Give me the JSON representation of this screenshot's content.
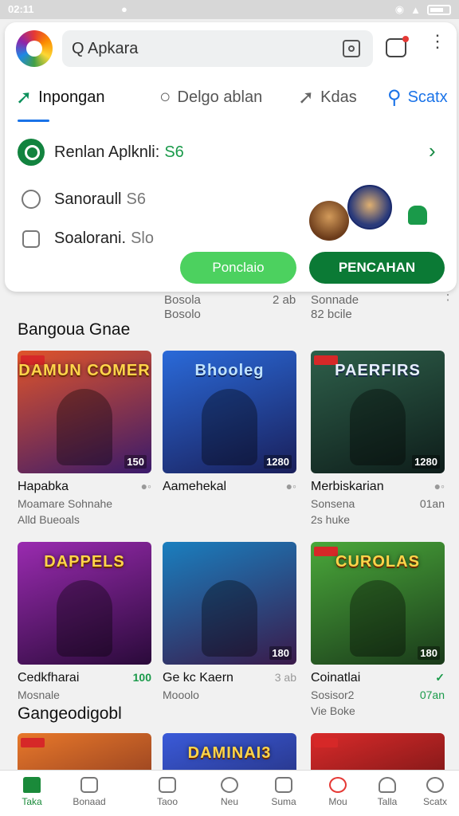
{
  "status": {
    "time": "02:11",
    "notif_icon": "bell-icon"
  },
  "header": {
    "search_value": "Q Apkara"
  },
  "tabs": [
    {
      "label": "Inpongan",
      "icon": "share-arrow-icon",
      "active": true
    },
    {
      "label": "Delgo ablan",
      "icon": "chat-bubble-icon"
    },
    {
      "label": "Kdas",
      "icon": "forward-arrow-icon"
    },
    {
      "label": "Scatx",
      "icon": "search-icon"
    }
  ],
  "options": [
    {
      "label": "Renlan Aplknli:",
      "badge": "S6"
    },
    {
      "label": "Sanoraull",
      "badge": "S6"
    },
    {
      "label": "Soalorani.",
      "badge": "Slo"
    }
  ],
  "buttons": {
    "light": "Ponclaio",
    "dark": "PENCAHAN"
  },
  "peek": {
    "col2": [
      "Bosola",
      "Bosolo"
    ],
    "col2_num": "2 ab",
    "col3": [
      "Sonnade",
      "82 bcile"
    ]
  },
  "sections": [
    "Bangoua Gnae",
    "Gangeodigobl"
  ],
  "games": [
    {
      "title": "DAMUN COMER",
      "name": "Hapabka",
      "sub1": "Moamare Sohnahe",
      "sub2": "Alld Bueoals",
      "num": "150",
      "colors": [
        "#e0542a",
        "#3a1a6b"
      ]
    },
    {
      "title": "Bhooleg",
      "name": "Aamehekal",
      "sub1": "",
      "sub2": "",
      "num": "1280",
      "colors": [
        "#2a6ad9",
        "#1a1f5a"
      ]
    },
    {
      "title": "PAERFIRS",
      "name": "Merbiskarian",
      "sub1": "Sonsena",
      "sub1_right": "01an",
      "sub2": "2s huke",
      "num": "1280",
      "colors": [
        "#2e5f4a",
        "#0e1d1a"
      ]
    },
    {
      "title": "DAPPELS",
      "name": "Cedkfharai",
      "name_right": "100",
      "sub1": "Mosnale",
      "sub2": "",
      "num": "",
      "colors": [
        "#9a2bb0",
        "#2a0a3a"
      ]
    },
    {
      "title": "",
      "name": "Ge kc Kaern",
      "name_right": "3 ab",
      "sub1": "Mooolo",
      "sub2": "",
      "num": "180",
      "colors": [
        "#1a7fbf",
        "#3a1a4a"
      ]
    },
    {
      "title": "CUROLAS",
      "name": "Coinatlai",
      "sub1": "Sosisor2",
      "sub1_right": "07an",
      "sub2": "Vie Boke",
      "num": "180",
      "colors": [
        "#4aa83a",
        "#1a3a1a"
      ]
    },
    {
      "title": "",
      "colors": [
        "#e8782a",
        "#5a1a1a"
      ]
    },
    {
      "title": "DAMINAI3",
      "colors": [
        "#3a5ad9",
        "#1a1a4a"
      ]
    },
    {
      "title": "",
      "colors": [
        "#d92a2a",
        "#3a0a0a"
      ]
    }
  ],
  "nav": [
    {
      "label": "Taka",
      "icon": "home-icon",
      "active": true
    },
    {
      "label": "Bonaad",
      "icon": "grid-icon"
    },
    {
      "label": "Taoo",
      "icon": "tag-icon"
    },
    {
      "label": "Neu",
      "icon": "plus-circle-icon"
    },
    {
      "label": "Suma",
      "icon": "calendar-icon"
    },
    {
      "label": "Mou",
      "icon": "search-pin-icon"
    },
    {
      "label": "Talla",
      "icon": "person-icon"
    },
    {
      "label": "Scatx",
      "icon": "search-icon"
    }
  ]
}
